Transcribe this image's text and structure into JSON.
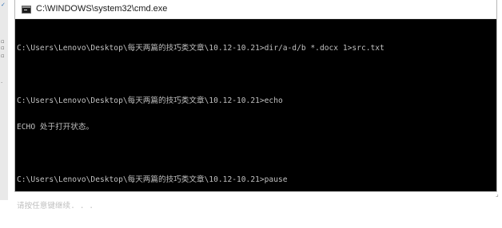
{
  "window": {
    "title": "C:\\WINDOWS\\system32\\cmd.exe",
    "icon": "cmd-icon"
  },
  "console": {
    "lines": [
      "C:\\Users\\Lenovo\\Desktop\\每天两篇的技巧类文章\\10.12-10.21>dir/a-d/b *.docx 1>src.txt",
      "",
      "C:\\Users\\Lenovo\\Desktop\\每天两篇的技巧类文章\\10.12-10.21>echo",
      "ECHO 处于打开状态。",
      "",
      "C:\\Users\\Lenovo\\Desktop\\每天两篇的技巧类文章\\10.12-10.21>pause",
      "请按任意键继续. . ."
    ]
  },
  "colors": {
    "console_background": "#000000",
    "console_text": "#c0c0c0",
    "titlebar_background": "#ffffff"
  }
}
